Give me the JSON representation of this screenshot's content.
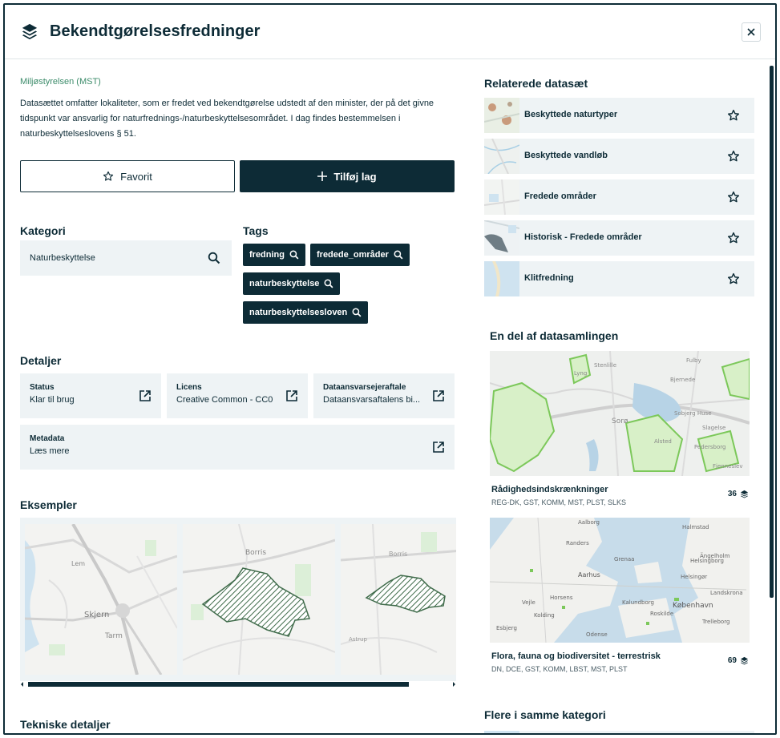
{
  "header": {
    "title": "Bekendtgørelsesfredninger",
    "icon": "layers-icon",
    "close_icon": "close-icon"
  },
  "dataset": {
    "organization": "Miljøstyrelsen (MST)",
    "description": "Datasættet omfatter lokaliteter, som er fredet ved bekendtgørelse udstedt af den minister, der på det givne tidspunkt var ansvarlig for naturfrednings-/naturbeskyttelsesområdet. I dag findes bestemmelsen i naturbeskyttelseslovens § 51."
  },
  "actions": {
    "favorite_label": "Favorit",
    "add_layer_label": "Tilføj lag"
  },
  "category": {
    "title": "Kategori",
    "value": "Naturbeskyttelse"
  },
  "tags": {
    "title": "Tags",
    "items": [
      "fredning",
      "fredede_områder",
      "naturbeskyttelse",
      "naturbeskyttelsesloven"
    ]
  },
  "details": {
    "title": "Detaljer",
    "items": [
      {
        "label": "Status",
        "value": "Klar til brug"
      },
      {
        "label": "Licens",
        "value": "Creative Common - CC0"
      },
      {
        "label": "Dataansvarsejeraftale",
        "value": "Dataansvarsaftalens bi..."
      },
      {
        "label": "Metadata",
        "value": "Læs mere"
      }
    ]
  },
  "examples": {
    "title": "Eksempler",
    "map_labels": [
      "Lem",
      "Skjern",
      "Tarm",
      "Borris",
      "Borris",
      "Astrup"
    ]
  },
  "technical": {
    "title": "Tekniske detaljer"
  },
  "related": {
    "title": "Relaterede datasæt",
    "items": [
      {
        "label": "Beskyttede naturtyper"
      },
      {
        "label": "Beskyttede vandløb"
      },
      {
        "label": "Fredede områder"
      },
      {
        "label": "Historisk - Fredede områder"
      },
      {
        "label": "Klitfredning"
      }
    ]
  },
  "collections": {
    "title": "En del af datasamlingen",
    "items": [
      {
        "name": "Rådighedsindskrænkninger",
        "orgs": "REG-DK, GST, KOMM, MST, PLST, SLKS",
        "count": "36",
        "map_labels": [
          "Fulby",
          "Stenlille",
          "Lyng",
          "Bjernede",
          "Sorø",
          "Alsted",
          "Sobjerg Huse",
          "Slagelse",
          "Pedersborg",
          "Fjenneslev"
        ]
      },
      {
        "name": "Flora, fauna og biodiversitet - terrestrisk",
        "orgs": "DN, DCE, GST, KOMM, LBST, MST, PLST",
        "count": "69",
        "map_labels": [
          "Aalborg",
          "Halmstad",
          "Randers",
          "Grenaa",
          "Helsingborg",
          "Aarhus",
          "Helsingør",
          "Horsens",
          "Vejle",
          "Kalundborg",
          "Kolding",
          "København",
          "Roskilde",
          "Odense",
          "Trelleborg",
          "Esbjerg",
          "Ängelholm",
          "Landskrona"
        ]
      }
    ]
  },
  "more_category": {
    "title": "Flere i samme kategori"
  },
  "colors": {
    "primary": "#0d2b36",
    "accent_green": "#3d8c6b",
    "panel_bg": "#eef3f5",
    "map_green": "#7cc85a"
  }
}
